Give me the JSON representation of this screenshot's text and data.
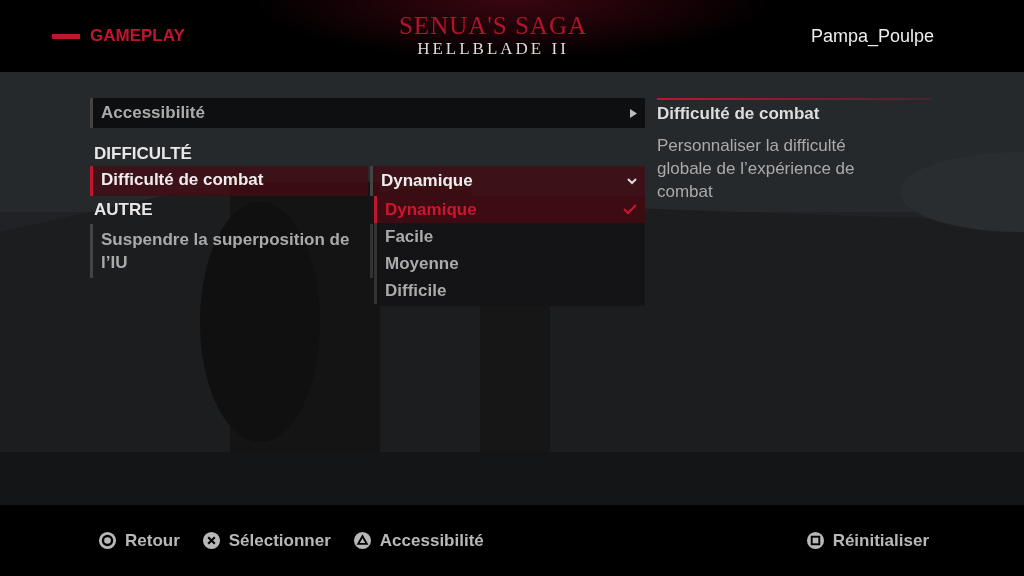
{
  "header": {
    "section": "GAMEPLAY",
    "logo_title": "SENUA'S SAGA",
    "logo_subtitle": "HELLBLADE II",
    "user": "Pampa_Poulpe"
  },
  "settings": [
    {
      "kind": "link",
      "label": "Accessibilité",
      "selected": false
    },
    {
      "kind": "heading",
      "label": "DIFFICULTÉ"
    },
    {
      "kind": "dropdown",
      "label": "Difficulté de combat",
      "selected": true,
      "value": "Dynamique",
      "expanded": true,
      "options": [
        {
          "label": "Dynamique",
          "selected": true
        },
        {
          "label": "Facile",
          "selected": false
        },
        {
          "label": "Moyenne",
          "selected": false
        },
        {
          "label": "Difficile",
          "selected": false
        }
      ]
    },
    {
      "kind": "heading",
      "label": "AUTRE"
    },
    {
      "kind": "option",
      "label": "Suspendre la superposition de l’IU",
      "selected": false
    }
  ],
  "info": {
    "title": "Difficulté de combat",
    "description": "Personnaliser la difficulté globale de l’expérience de combat"
  },
  "footer": {
    "left": [
      {
        "kind": "circle",
        "label": "Retour"
      },
      {
        "kind": "cross",
        "label": "Sélectionner"
      },
      {
        "kind": "triangle",
        "label": "Accessibilité"
      }
    ],
    "right": [
      {
        "kind": "square",
        "label": "Réinitialiser"
      }
    ]
  }
}
